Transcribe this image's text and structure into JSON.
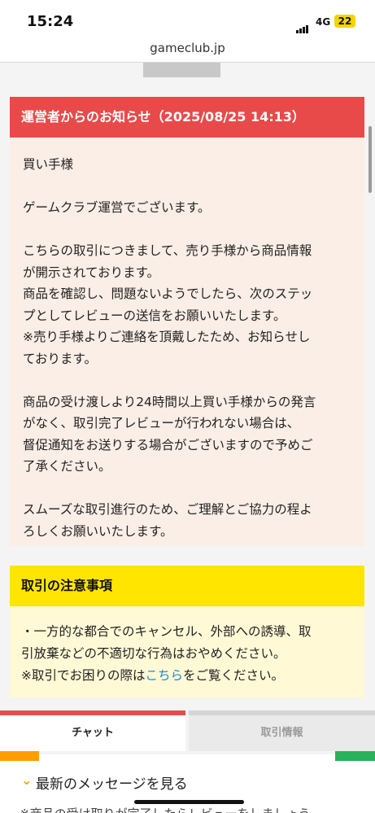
{
  "status": {
    "time": "15:24",
    "network": "4G",
    "battery": "22"
  },
  "browser": {
    "url": "gameclub.jp"
  },
  "notice": {
    "title": "運営者からのお知らせ（2025/08/25 14:13）",
    "paragraphs": [
      "買い手様",
      "ゲームクラブ運営でございます。",
      "こちらの取引につきまして、売り手様から商品情報\nが開示されております。\n商品を確認し、問題ないようでしたら、次のステッ\nプとしてレビューの送信をお願いいたします。\n※売り手様よりご連絡を頂戴したため、お知らせし\nております。",
      "商品の受け渡しより24時間以上買い手様からの発言\nがなく、取引完了レビューが行われない場合は、\n督促通知をお送りする場合がございますので予めご\n了承ください。",
      "スムーズな取引進行のため、ご理解とご協力の程よ\nろしくお願いいたします。"
    ]
  },
  "caution": {
    "title": "取引の注意事項",
    "line1": "・一方的な都合でのキャンセル、外部への誘導、取\n引放棄などの不適切な行為はおやめください。",
    "line2_prefix": "※取引でお困りの際は",
    "line2_link": "こちら",
    "line2_suffix": "をご覧ください。"
  },
  "tabs": {
    "chat": "チャット",
    "info": "取引情報"
  },
  "latest": {
    "label": "最新のメッセージを見る"
  },
  "bottom_peek": "※商品の受け取りが完了したらレビューをしましょう。",
  "colors": {
    "notice_header": "#e84a4a",
    "caution_header": "#ffe500",
    "link": "#1a8ad8",
    "accent_orange": "#ff9d00",
    "accent_green": "#27b35a"
  }
}
